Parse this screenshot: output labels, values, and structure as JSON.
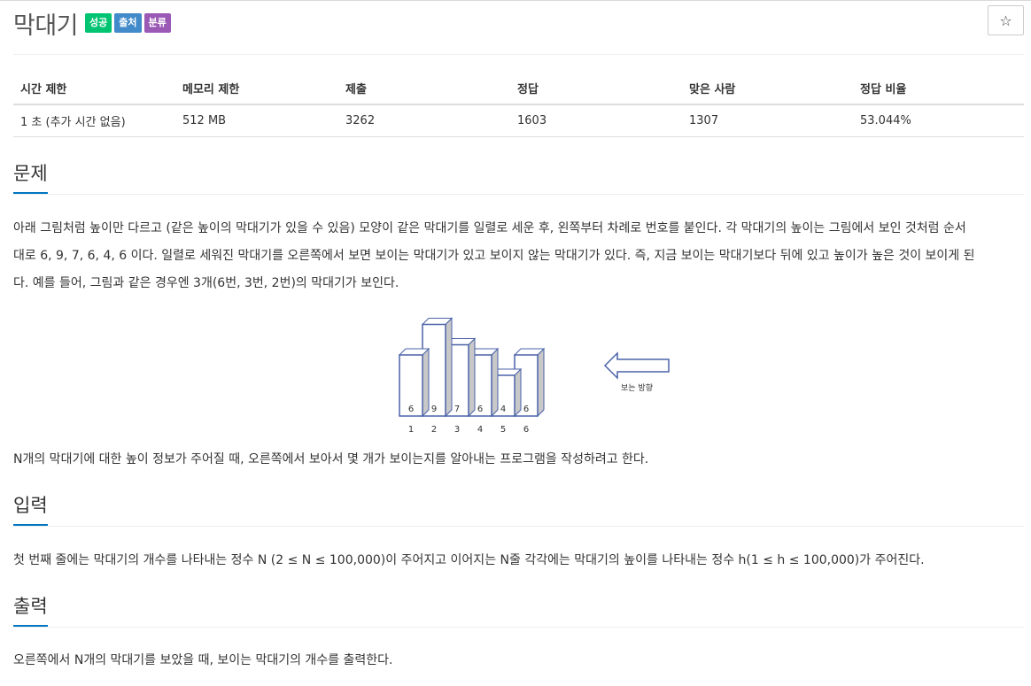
{
  "problem": {
    "title": "막대기",
    "labels": [
      {
        "text": "성공",
        "color": "#00c471"
      },
      {
        "text": "출처",
        "color": "#428bca"
      },
      {
        "text": "분류",
        "color": "#9b59b6"
      }
    ],
    "star_icon": "☆"
  },
  "info_table": {
    "headers": [
      "시간 제한",
      "메모리 제한",
      "제출",
      "정답",
      "맞은 사람",
      "정답 비율"
    ],
    "values": [
      "1 초 (추가 시간 없음)",
      "512 MB",
      "3262",
      "1603",
      "1307",
      "53.044%"
    ]
  },
  "sections": {
    "description": {
      "heading": "문제",
      "lines": [
        "아래 그림처럼 높이만 다르고 (같은 높이의 막대기가 있을 수 있음) 모양이 같은 막대기를 일렬로 세운 후, 왼쪽부터 차례로 번호를 붙인다. 각 막대기의 높이는 그림에서 보인 것처럼 순서",
        "대로 6, 9, 7, 6, 4, 6 이다. 일렬로 세워진 막대기를 오른쪽에서 보면 보이는 막대기가 있고 보이지 않는 막대기가 있다. 즉, 지금 보이는 막대기보다 뒤에 있고 높이가 높은 것이 보이게 된",
        "다. 예를 들어, 그림과 같은 경우엔 3개(6번, 3번, 2번)의 막대기가 보인다."
      ],
      "after_figure": "N개의 막대기에 대한 높이 정보가 주어질 때, 오른쪽에서 보아서 몇 개가 보이는지를 알아내는 프로그램을 작성하려고 한다."
    },
    "input": {
      "heading": "입력",
      "text": "첫 번째 줄에는 막대기의 개수를 나타내는 정수 N (2 ≤ N ≤ 100,000)이 주어지고 이어지는 N줄 각각에는 막대기의 높이를 나타내는 정수 h(1 ≤ h ≤ 100,000)가 주어진다."
    },
    "output": {
      "heading": "출력",
      "text": "오른쪽에서 N개의 막대기를 보았을 때, 보이는 막대기의 개수를 출력한다."
    }
  },
  "figure": {
    "bars": [
      {
        "height": 6,
        "label": "6",
        "index": "1"
      },
      {
        "height": 9,
        "label": "9",
        "index": "2"
      },
      {
        "height": 7,
        "label": "7",
        "index": "3"
      },
      {
        "height": 6,
        "label": "6",
        "index": "4"
      },
      {
        "height": 4,
        "label": "4",
        "index": "5"
      },
      {
        "height": 6,
        "label": "6",
        "index": "6"
      }
    ],
    "arrow_caption": "보는 방향",
    "stroke_color": "#4a62a8",
    "shade_color": "#c8c8c8"
  }
}
